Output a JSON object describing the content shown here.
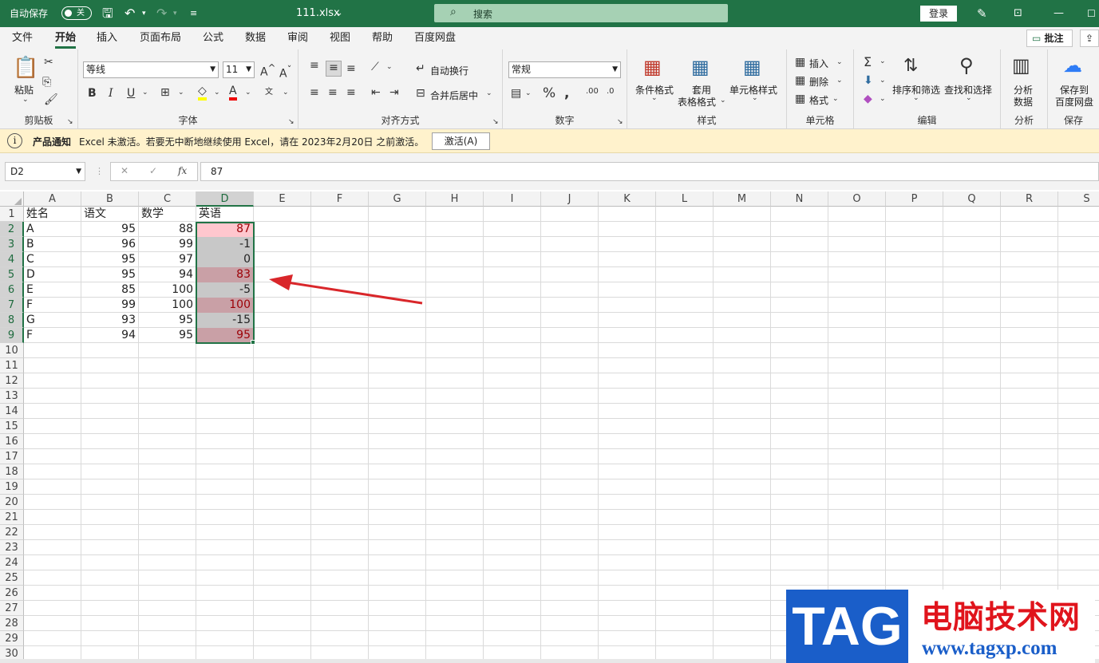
{
  "titlebar": {
    "autosave_label": "自动保存",
    "autosave_state": "关",
    "filename": "111.xlsx",
    "search_placeholder": "搜索",
    "login_label": "登录"
  },
  "tabs": [
    "文件",
    "开始",
    "插入",
    "页面布局",
    "公式",
    "数据",
    "审阅",
    "视图",
    "帮助",
    "百度网盘"
  ],
  "active_tab": "开始",
  "comment_button": "批注",
  "ribbon": {
    "clipboard": {
      "paste": "粘贴",
      "group": "剪贴板"
    },
    "font": {
      "name": "等线",
      "size": "11",
      "group": "字体"
    },
    "alignment": {
      "wrap": "自动换行",
      "merge": "合并后居中",
      "group": "对齐方式"
    },
    "number": {
      "format": "常规",
      "group": "数字"
    },
    "styles": {
      "conditional": "条件格式",
      "table_line1": "套用",
      "table_line2": "表格格式",
      "cell_styles": "单元格样式",
      "group": "样式"
    },
    "cells": {
      "insert": "插入",
      "delete": "删除",
      "format": "格式",
      "group": "单元格"
    },
    "editing": {
      "sort": "排序和筛选",
      "find": "查找和选择",
      "group": "编辑"
    },
    "analysis": {
      "line1": "分析",
      "line2": "数据",
      "group": "分析"
    },
    "save": {
      "line1": "保存到",
      "line2": "百度网盘",
      "group": "保存"
    }
  },
  "notice": {
    "title": "产品通知",
    "message": "Excel 未激活。若要无中断地继续使用 Excel，请在 2023年2月20日 之前激活。",
    "button": "激活(A)"
  },
  "formula_bar": {
    "cell_ref": "D2",
    "fx": "fx",
    "content": "87"
  },
  "sheet": {
    "columns": [
      "A",
      "B",
      "C",
      "D",
      "E",
      "F",
      "G",
      "H",
      "I",
      "J",
      "K",
      "L",
      "M",
      "N",
      "O",
      "P",
      "Q",
      "R",
      "S"
    ],
    "selected_column": "D",
    "row_numbers": [
      "1",
      "2",
      "3",
      "4",
      "5",
      "6",
      "7",
      "8",
      "9",
      "10",
      "11",
      "12",
      "13",
      "14",
      "15",
      "16",
      "17",
      "18",
      "19",
      "20",
      "21",
      "22",
      "23",
      "24",
      "25",
      "26",
      "27",
      "28",
      "29",
      "30"
    ],
    "header": [
      "姓名",
      "语文",
      "数学",
      "英语"
    ],
    "rows": [
      [
        "A",
        "95",
        "88",
        "87"
      ],
      [
        "B",
        "96",
        "99",
        "-1"
      ],
      [
        "C",
        "95",
        "97",
        "0"
      ],
      [
        "D",
        "95",
        "94",
        "83"
      ],
      [
        "E",
        "85",
        "100",
        "-5"
      ],
      [
        "F",
        "99",
        "100",
        "100"
      ],
      [
        "G",
        "93",
        "95",
        "-15"
      ],
      [
        "F",
        "94",
        "95",
        "95"
      ]
    ],
    "d_highlight": [
      "pink",
      "gray",
      "gray",
      "rose",
      "gray",
      "rose",
      "gray",
      "rose"
    ]
  },
  "colors": {
    "accent": "#217346",
    "pink_fill": "#ffc7ce",
    "rose_fill": "#c9a0a6",
    "gray_fill": "#c8c8c8",
    "red_text": "#9c0006",
    "arrow": "#d9262a"
  },
  "watermark": {
    "logo": "TAG",
    "site_name": "电脑技术网",
    "url": "www.tagxp.com"
  }
}
